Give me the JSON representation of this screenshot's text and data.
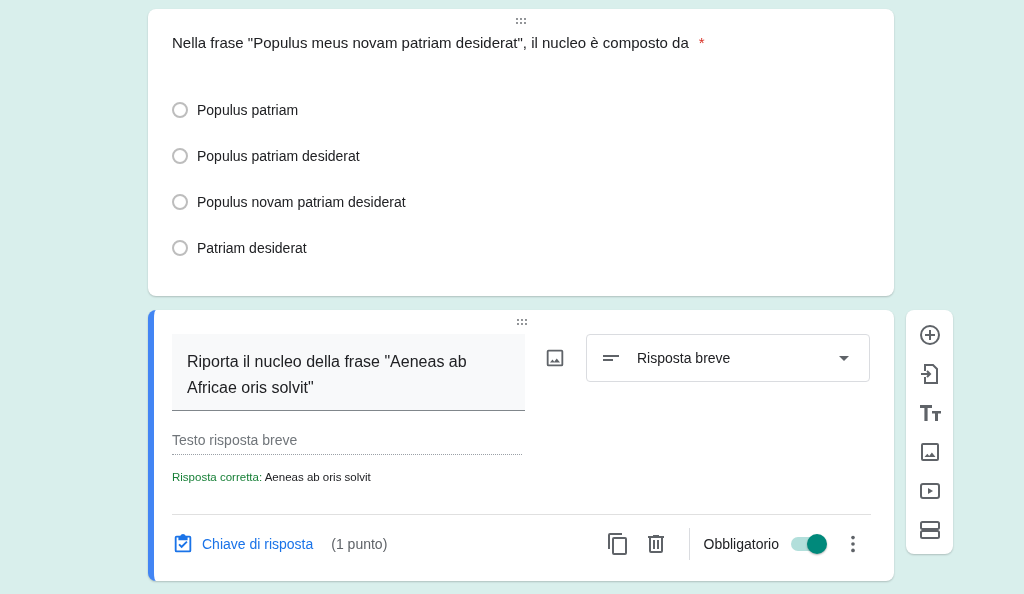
{
  "question_1": {
    "title": "Nella frase \"Populus meus novam patriam desiderat\", il nucleo è composto da",
    "required_mark": "*",
    "options": [
      {
        "label": "Populus patriam",
        "selected": false
      },
      {
        "label": "Populus patriam desiderat",
        "selected": false
      },
      {
        "label": "Populus novam patriam desiderat",
        "selected": false
      },
      {
        "label": "Patriam desiderat",
        "selected": false
      }
    ]
  },
  "question_2": {
    "title": "Riporta il nucleo della frase \"Aeneas ab Africae oris solvit\"",
    "type_dropdown": "Risposta breve",
    "answer_placeholder": "Testo risposta breve",
    "correct_label": "Risposta corretta:",
    "correct_value": "Aeneas ab oris solvit",
    "answer_key": "Chiave di risposta",
    "points": "(1 punto)",
    "required_label": "Obbligatorio",
    "required": {
      "on": true
    }
  }
}
